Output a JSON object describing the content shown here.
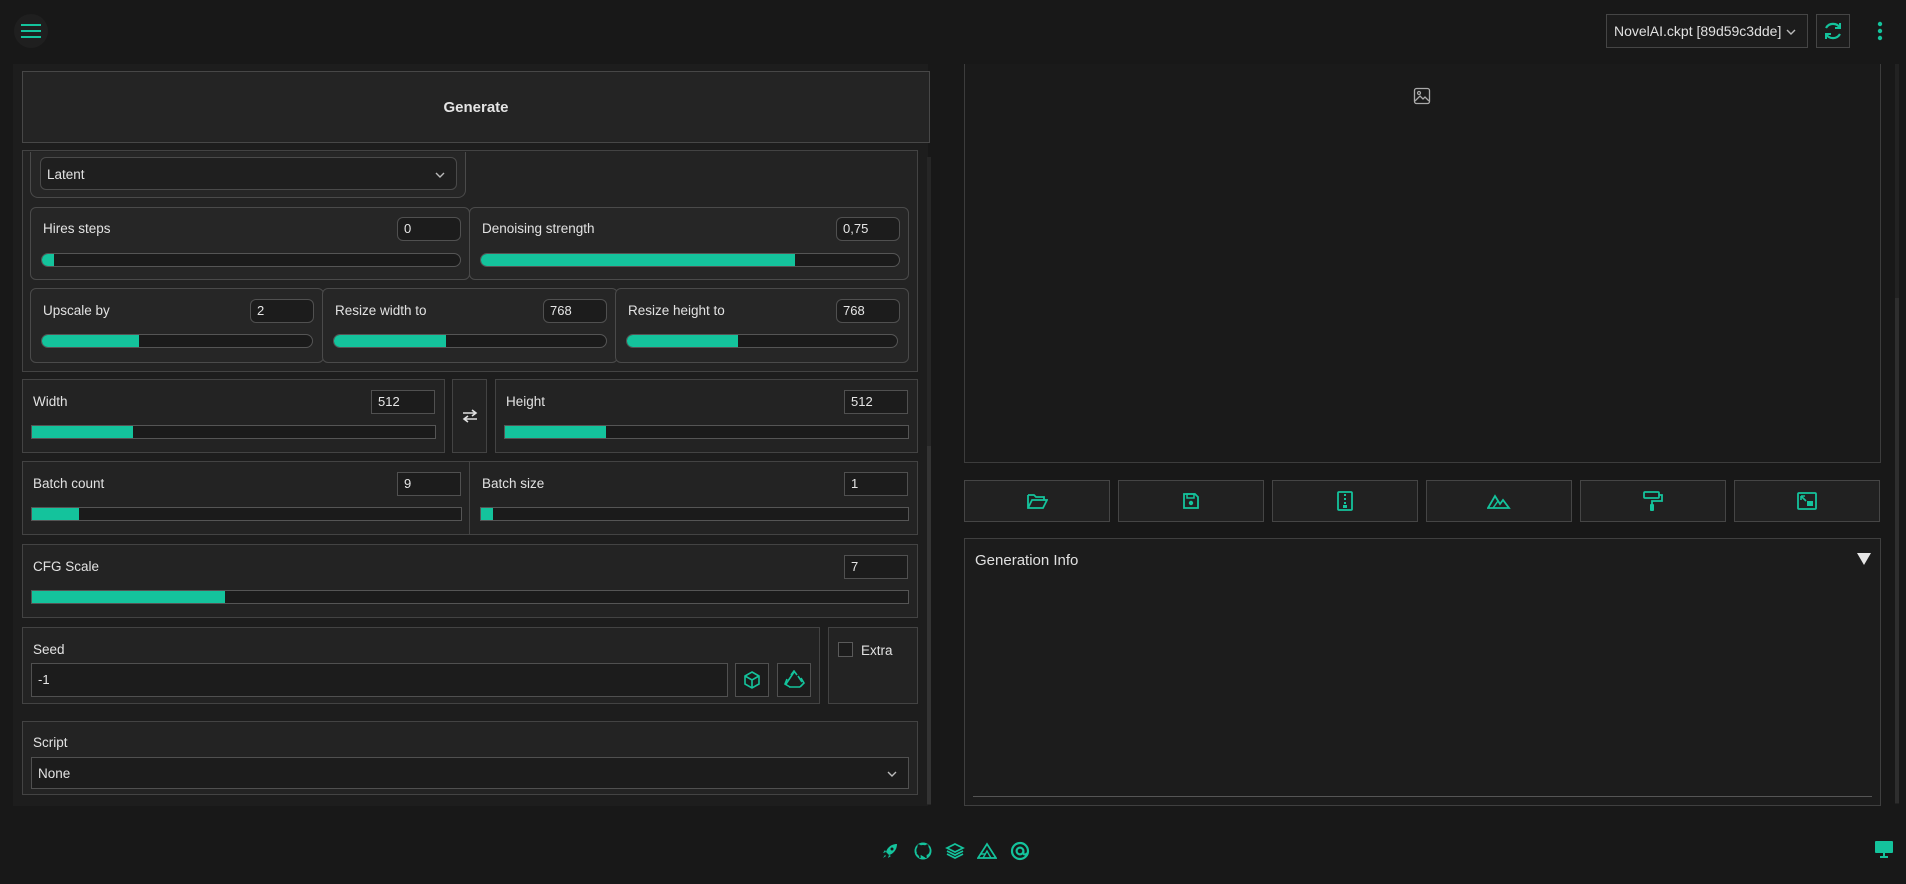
{
  "header": {
    "model_select_value": "NovelAI.ckpt [89d59c3dde]"
  },
  "generate": {
    "label": "Generate"
  },
  "hires": {
    "upscaler_value": "Latent",
    "steps": {
      "label": "Hires steps",
      "value": "0",
      "fraction": 0.0
    },
    "denoising": {
      "label": "Denoising strength",
      "value": "0,75",
      "fraction": 0.75
    },
    "upscale_by": {
      "label": "Upscale by",
      "value": "2",
      "fraction": 0.36
    },
    "resize_width": {
      "label": "Resize width to",
      "value": "768",
      "fraction": 0.41
    },
    "resize_height": {
      "label": "Resize height to",
      "value": "768",
      "fraction": 0.41
    }
  },
  "dimensions": {
    "width": {
      "label": "Width",
      "value": "512",
      "fraction": 0.25
    },
    "height": {
      "label": "Height",
      "value": "512",
      "fraction": 0.25
    },
    "swap_icon": "swap-arrows-icon"
  },
  "batch": {
    "count": {
      "label": "Batch count",
      "value": "9",
      "fraction": 0.11
    },
    "size": {
      "label": "Batch size",
      "value": "1",
      "fraction": 0.0
    }
  },
  "cfg": {
    "label": "CFG Scale",
    "value": "7",
    "fraction": 0.22
  },
  "seed": {
    "label": "Seed",
    "value": "-1",
    "random_icon": "dice-cube-icon",
    "reuse_icon": "recycle-icon",
    "extra_label": "Extra"
  },
  "script": {
    "label": "Script",
    "value": "None"
  },
  "output": {
    "tool_icons": [
      "folder-open-icon",
      "save-icon",
      "zip-icon",
      "send-to-img2img-icon",
      "send-to-inpaint-icon",
      "send-to-extras-icon"
    ],
    "generation_info_title": "Generation Info"
  },
  "footer_icons": [
    "rocket-icon",
    "github-icon",
    "layers-icon",
    "triangle-ruler-icon",
    "at-sign-icon",
    "monitor-icon"
  ],
  "colors": {
    "accent": "#14c39c",
    "background": "#181818",
    "panel": "#232323"
  }
}
